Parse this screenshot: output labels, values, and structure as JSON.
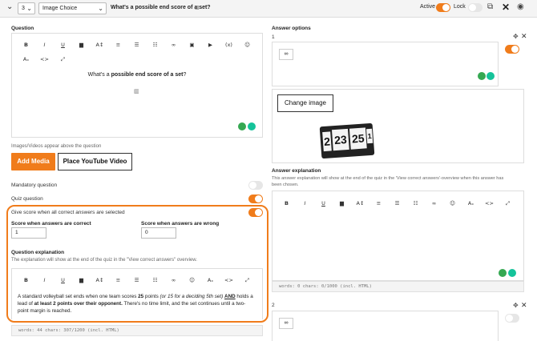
{
  "header": {
    "question_number": "3",
    "question_type": "Image Choice",
    "question_title": "What's a possible end score of a set?",
    "active_label": "Active",
    "lock_label": "Lock"
  },
  "question": {
    "section_label": "Question",
    "text_prefix": "What's a ",
    "text_bold": "possible end score of a set",
    "text_suffix": "?",
    "media_note": "Images/Videos appear above the question",
    "add_media_label": "Add Media",
    "youtube_label": "Place YouTube Video",
    "mandatory_label": "Mandatory question",
    "quiz_label": "Quiz question",
    "give_score_label": "Give score when all correct answers are selected",
    "score_correct_label": "Score when answers are correct",
    "score_correct_value": "1",
    "score_wrong_label": "Score when answers are wrong",
    "score_wrong_value": "0",
    "explanation_label": "Question explanation",
    "explanation_note": "The explanation will show at the end of the quiz in the \"View correct answers\" overview.",
    "explanation_line1_a": "A standard volleyball set ends when one team scores ",
    "explanation_line1_b": "25",
    "explanation_line1_c": " points ",
    "explanation_line1_d": "(or 15 for a deciding 5th set)",
    "explanation_line1_e": " ",
    "explanation_line1_f": "AND",
    "explanation_line1_g": " holds a",
    "explanation_line2_a": "lead of ",
    "explanation_line2_b": "at least 2 points over their opponent.",
    "explanation_line2_c": " There's no time limit, and the set continues until a two-",
    "explanation_line3": "point margin is reached.",
    "word_stats": "words: 44   chars: 307/1200 (incl. HTML)"
  },
  "answers": {
    "section_label": "Answer options",
    "option1_number": "1",
    "change_image_label": "Change image",
    "scoreboard_digits": [
      "2",
      "23",
      "25",
      "1"
    ],
    "explanation_label": "Answer explanation",
    "explanation_note_line1": "This answer explanation will show at the end of the quiz in the 'View correct answers'-overview when this answer has",
    "explanation_note_line2": "been chosen.",
    "word_stats": "words: 0   chars: 0/1000 (incl. HTML)",
    "option2_number": "2"
  },
  "toolbar_icons": [
    "B",
    "I",
    "U",
    "A",
    "A↕",
    "≡",
    "☰",
    "☷",
    "∞",
    "▣",
    "▶",
    "(x)",
    "☺",
    "Aₓ",
    "<>",
    "⤢"
  ],
  "colors": {
    "accent": "#f07c1b",
    "green": "#35a852"
  }
}
